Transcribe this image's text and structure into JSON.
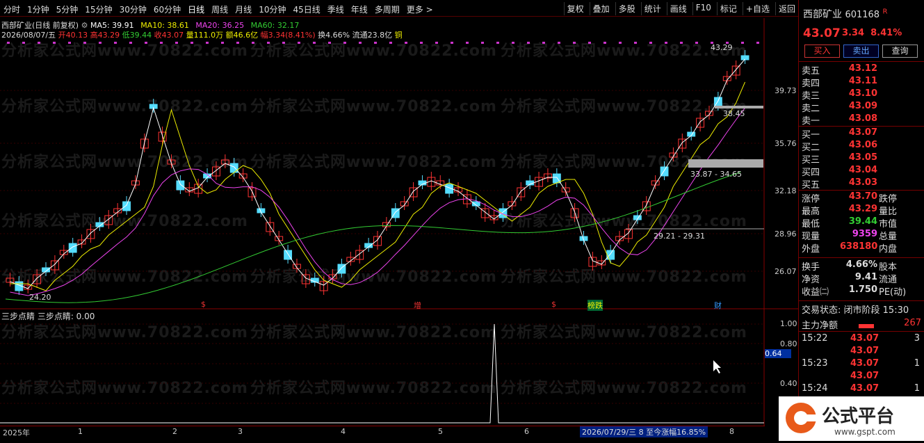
{
  "toolbar": {
    "periods": [
      "分时",
      "1分钟",
      "5分钟",
      "15分钟",
      "30分钟",
      "60分钟",
      "日线",
      "周线",
      "月线",
      "10分钟",
      "45日线",
      "季线",
      "年线",
      "多周期",
      "更多 >"
    ],
    "actions": [
      "复权",
      "叠加",
      "多股",
      "统计",
      "画线",
      "F10",
      "标记",
      "+自选",
      "返回"
    ]
  },
  "info": {
    "title": "西部矿业(日线 前复权)",
    "ma5": "MA5: 39.91",
    "ma10": "MA10: 38.61",
    "ma20": "MA20: 36.25",
    "ma60": "MA60: 32.17",
    "date": "2026/08/07/五",
    "open": "开40.13",
    "high": "高43.29",
    "low": "低39.44",
    "close": "收43.07",
    "vol": "量111.0万",
    "amt": "额46.6亿",
    "amp": "幅3.34(8.41%)",
    "turn": "换4.66%",
    "circ": "流通23.8亿",
    "tag": "铜"
  },
  "watermark": "分析家公式网www.70822.com",
  "ylabels": [
    "39.73",
    "35.76",
    "32.18",
    "28.96",
    "26.07"
  ],
  "annot": {
    "high": "43.29",
    "low": "24.20",
    "r1": "38.45",
    "r2": "33.87 - 34.65",
    "r3": "29.21 - 29.31"
  },
  "marks": [
    "$",
    "增",
    "$",
    "榜跌",
    "财"
  ],
  "sub": {
    "title": "三步点睛  三步点睛: 0.00",
    "labels": [
      "1.00",
      "0.80",
      "0.64",
      "0.40"
    ]
  },
  "axis": [
    "2025年",
    "1",
    "2",
    "3",
    "4",
    "5",
    "6",
    "8"
  ],
  "status": "2026/07/29/三 8 至今涨幅16.85%",
  "quote": {
    "name": "西部矿业",
    "code": "601168",
    "flag": "R",
    "price": "43.07",
    "chg": "3.34",
    "pct": "8.41%",
    "buy": "买入",
    "sell": "卖出",
    "query": "查询"
  },
  "asks": [
    [
      "卖五",
      "43.12"
    ],
    [
      "卖四",
      "43.11"
    ],
    [
      "卖三",
      "43.10"
    ],
    [
      "卖二",
      "43.09"
    ],
    [
      "卖一",
      "43.08"
    ]
  ],
  "bids": [
    [
      "买一",
      "43.07"
    ],
    [
      "买二",
      "43.06"
    ],
    [
      "买三",
      "43.05"
    ],
    [
      "买四",
      "43.04"
    ],
    [
      "买五",
      "43.03"
    ]
  ],
  "stats": [
    [
      "涨停",
      "43.70",
      "跌停"
    ],
    [
      "最高",
      "43.29",
      "量比"
    ],
    [
      "最低",
      "39.44",
      "市值"
    ],
    [
      "现量",
      "9359",
      "总量"
    ],
    [
      "外盘",
      "638180",
      "内盘"
    ]
  ],
  "stats2": [
    [
      "换手",
      "4.66%",
      "股本"
    ],
    [
      "净资",
      "9.41",
      "流通"
    ],
    [
      "收益㈡",
      "1.750",
      "PE(动)"
    ]
  ],
  "trade": {
    "state": "交易状态: 闭市阶段",
    "time": "15:30",
    "net": "主力净额",
    "netval": "267",
    "rows": [
      [
        "15:22",
        "43.07",
        "3"
      ],
      [
        "",
        "43.07",
        ""
      ],
      [
        "15:23",
        "43.07",
        "1"
      ],
      [
        "",
        "43.07",
        ""
      ],
      [
        "15:24",
        "43.07",
        "1"
      ],
      [
        "",
        "43.07",
        ""
      ]
    ]
  },
  "logo": {
    "text": "公式平台",
    "url": "www.gspt.com"
  }
}
